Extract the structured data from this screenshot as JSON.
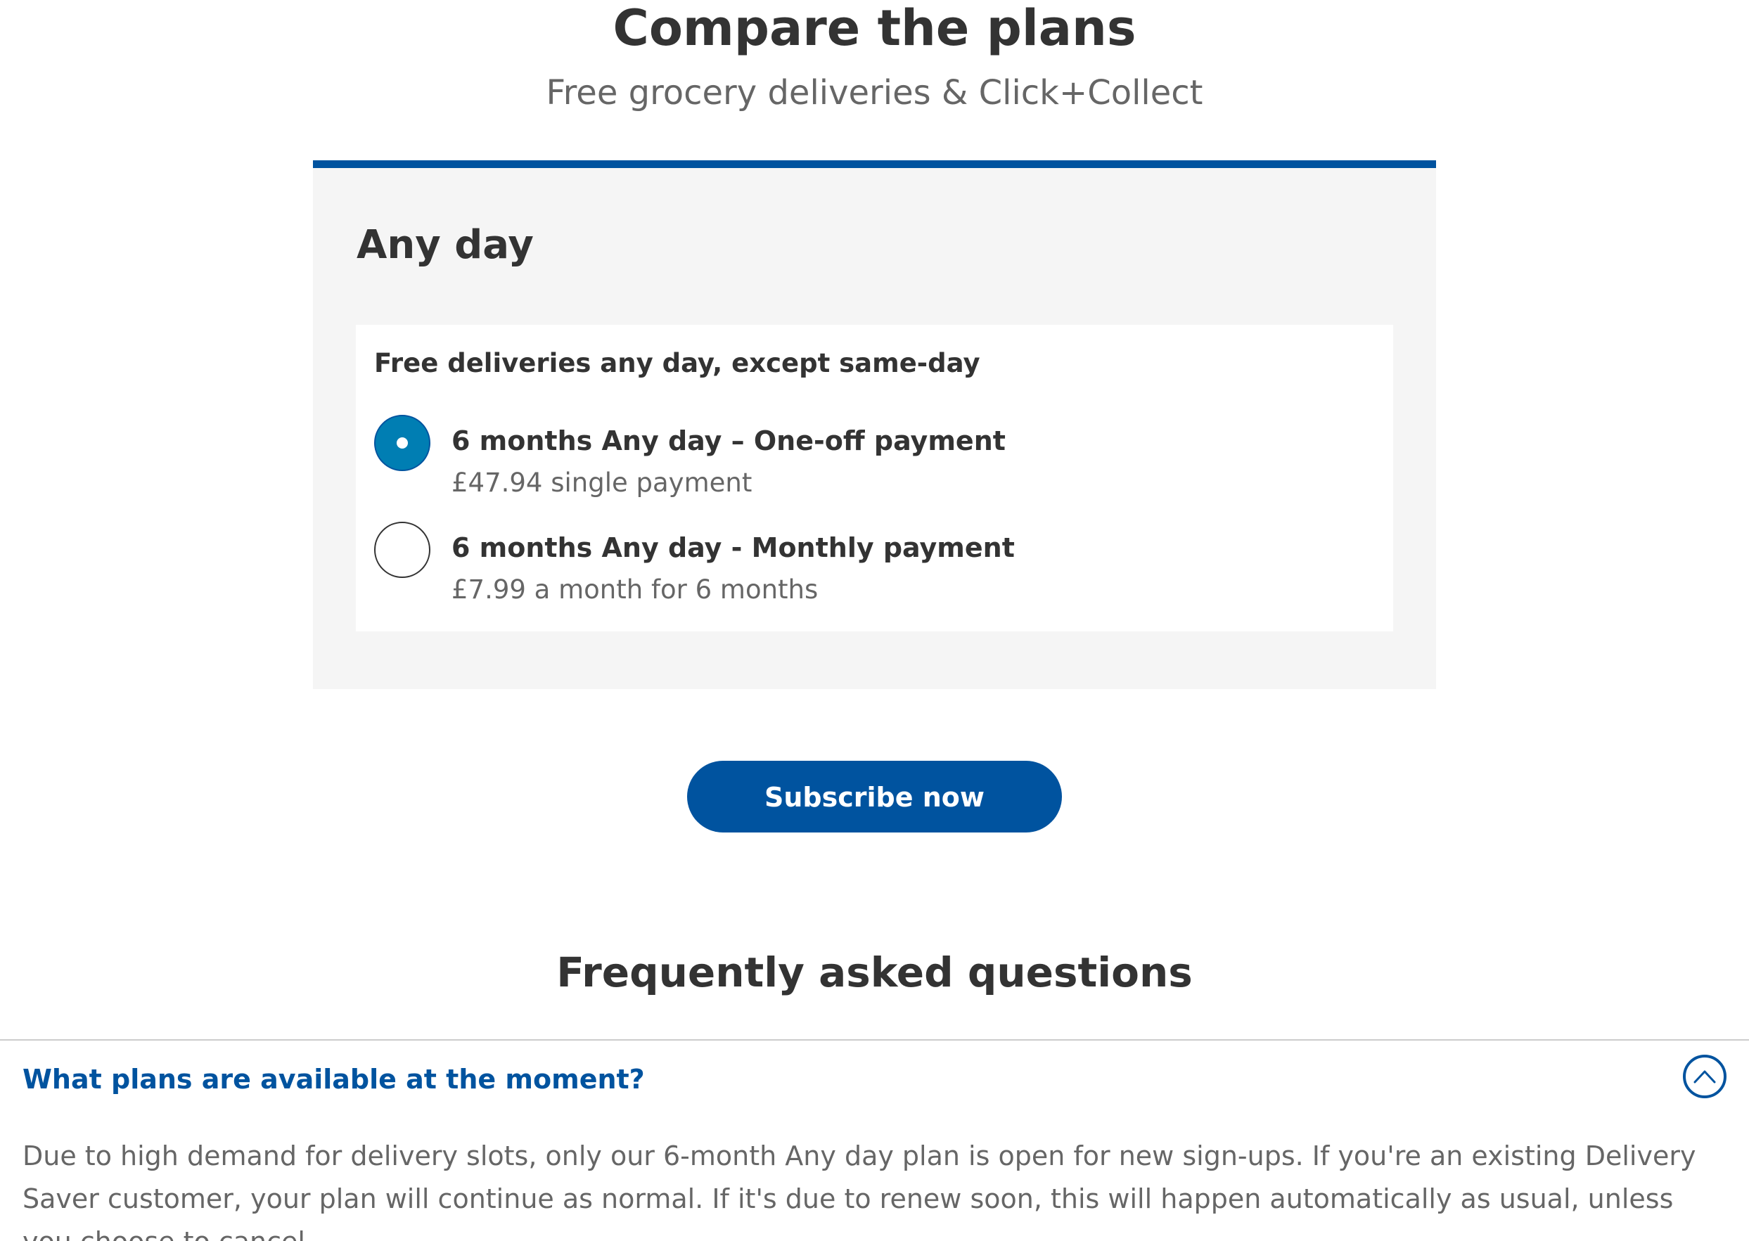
{
  "header": {
    "title": "Compare the plans",
    "subtitle": "Free grocery deliveries & Click+Collect"
  },
  "plan": {
    "heading": "Any day",
    "card_heading": "Free deliveries any day, except same-day",
    "options": [
      {
        "title": "6 months Any day – One-off payment",
        "detail": "£47.94 single payment",
        "selected": true
      },
      {
        "title": "6 months Any day - Monthly payment",
        "detail": "£7.99 a month for 6 months",
        "selected": false
      }
    ]
  },
  "subscribe": {
    "label": "Subscribe now"
  },
  "faq": {
    "title": "Frequently asked questions",
    "items": [
      {
        "question": "What plans are available at the moment?",
        "answer": "Due to high demand for delivery slots, only our 6-month Any day plan is open for new sign-ups. If you're an existing Delivery Saver customer, your plan will continue as normal. If it's due to renew soon, this will happen automatically as usual, unless you choose to cancel.",
        "expanded": true,
        "toggle_icon": "chevron-up-icon"
      }
    ]
  },
  "colors": {
    "brand_blue": "#00539f",
    "radio_selected": "#007eb3",
    "panel_bg": "#f5f5f5",
    "text_dark": "#333333",
    "text_muted": "#666666"
  }
}
